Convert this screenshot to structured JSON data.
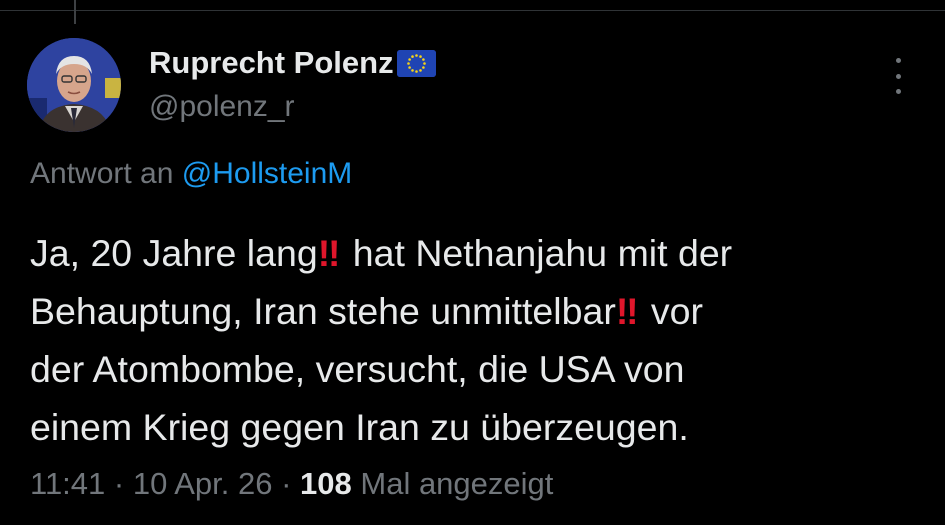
{
  "author": {
    "display_name": "Ruprecht Polenz",
    "handle": "@polenz_r",
    "flag_icon": "eu-flag-icon"
  },
  "reply": {
    "prefix": "Antwort an",
    "mention": "@HollsteinM"
  },
  "tweet": {
    "lines": [
      {
        "before": "Ja, 20 Jahre lang",
        "emoji": "‼",
        "after": " hat Nethanjahu mit der"
      },
      {
        "before": "Behauptung, Iran stehe unmittelbar",
        "emoji": "‼",
        "after": " vor"
      },
      {
        "before": "der Atombombe, versucht, die USA von",
        "emoji": "",
        "after": ""
      },
      {
        "before": "einem Krieg gegen Iran zu überzeugen.",
        "emoji": "",
        "after": ""
      }
    ]
  },
  "meta": {
    "time": "11:41",
    "sep1": " · ",
    "date": "10 Apr. 26",
    "sep2": " · ",
    "views_count": "108",
    "views_label": " Mal angezeigt"
  },
  "colors": {
    "background": "#000000",
    "text": "#e7e9ea",
    "secondary": "#71767b",
    "link": "#1d9bf0",
    "emoji_red": "#e0162b"
  }
}
